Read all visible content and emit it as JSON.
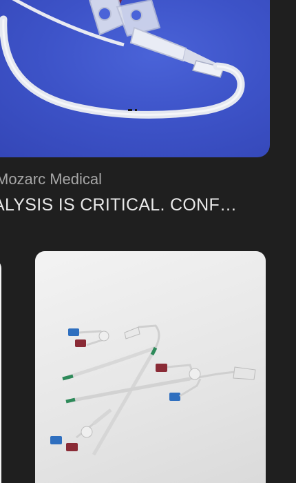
{
  "feed": {
    "top_card": {
      "image_icon": "catheter-photo-icon",
      "source": "Mozarc Medical",
      "headline": "ALYSIS IS CRITICAL. CONF…"
    },
    "bottom_card": {
      "image_icon": "catheter-product-photo-icon"
    }
  },
  "colors": {
    "background": "#1f1f1f",
    "photo_blue": "#3d53c8",
    "source_text": "#a6a6a6",
    "headline_text": "#e9e9e9"
  }
}
